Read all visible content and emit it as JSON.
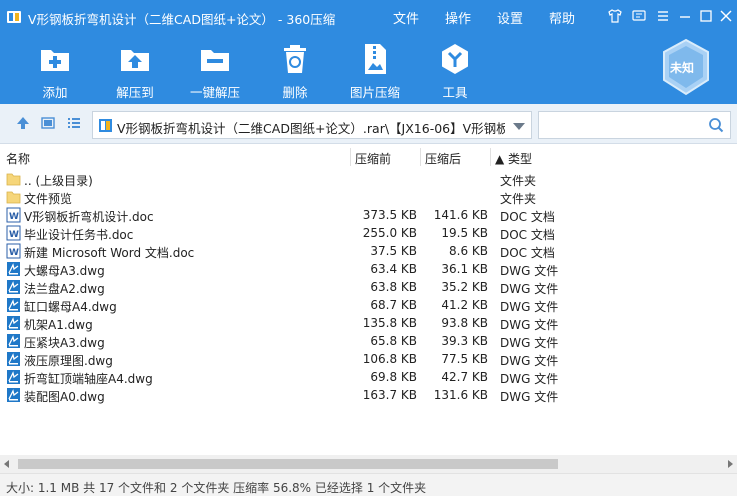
{
  "window": {
    "title": "V形钢板折弯机设计（二维CAD图纸+论文） - 360压缩",
    "menus": [
      "文件",
      "操作",
      "设置",
      "帮助"
    ],
    "accent": "#2f8be0"
  },
  "toolbar": {
    "items": [
      {
        "label": "添加",
        "icon": "add-icon"
      },
      {
        "label": "解压到",
        "icon": "extract-to-icon"
      },
      {
        "label": "一键解压",
        "icon": "one-click-extract-icon"
      },
      {
        "label": "删除",
        "icon": "delete-icon"
      },
      {
        "label": "图片压缩",
        "icon": "image-compress-icon"
      },
      {
        "label": "工具",
        "icon": "tools-icon"
      }
    ],
    "badge_label": "未知"
  },
  "address": {
    "path": "V形钢板折弯机设计（二维CAD图纸+论文）.rar\\【JX16-06】V形钢板折",
    "search_placeholder": ""
  },
  "columns": {
    "name": "名称",
    "compressed": "压缩前",
    "original": "压缩后",
    "type": "▲ 类型"
  },
  "rows": [
    {
      "name": ".. (上级目录)",
      "compressed": "",
      "original": "",
      "type": "文件夹",
      "icon": "folder-icon"
    },
    {
      "name": "文件预览",
      "compressed": "",
      "original": "",
      "type": "文件夹",
      "icon": "folder-icon"
    },
    {
      "name": "V形钢板折弯机设计.doc",
      "compressed": "373.5 KB",
      "original": "141.6 KB",
      "type": "DOC 文档",
      "icon": "doc-icon"
    },
    {
      "name": "毕业设计任务书.doc",
      "compressed": "255.0 KB",
      "original": "19.5 KB",
      "type": "DOC 文档",
      "icon": "doc-icon"
    },
    {
      "name": "新建 Microsoft Word 文档.doc",
      "compressed": "37.5 KB",
      "original": "8.6 KB",
      "type": "DOC 文档",
      "icon": "doc-icon"
    },
    {
      "name": "大螺母A3.dwg",
      "compressed": "63.4 KB",
      "original": "36.1 KB",
      "type": "DWG 文件",
      "icon": "dwg-icon"
    },
    {
      "name": "法兰盘A2.dwg",
      "compressed": "63.8 KB",
      "original": "35.2 KB",
      "type": "DWG 文件",
      "icon": "dwg-icon"
    },
    {
      "name": "缸口螺母A4.dwg",
      "compressed": "68.7 KB",
      "original": "41.2 KB",
      "type": "DWG 文件",
      "icon": "dwg-icon"
    },
    {
      "name": "机架A1.dwg",
      "compressed": "135.8 KB",
      "original": "93.8 KB",
      "type": "DWG 文件",
      "icon": "dwg-icon"
    },
    {
      "name": "压紧块A3.dwg",
      "compressed": "65.8 KB",
      "original": "39.3 KB",
      "type": "DWG 文件",
      "icon": "dwg-icon"
    },
    {
      "name": "液压原理图.dwg",
      "compressed": "106.8 KB",
      "original": "77.5 KB",
      "type": "DWG 文件",
      "icon": "dwg-icon"
    },
    {
      "name": "折弯缸顶端轴座A4.dwg",
      "compressed": "69.8 KB",
      "original": "42.7 KB",
      "type": "DWG 文件",
      "icon": "dwg-icon"
    },
    {
      "name": "装配图A0.dwg",
      "compressed": "163.7 KB",
      "original": "131.6 KB",
      "type": "DWG 文件",
      "icon": "dwg-icon"
    }
  ],
  "status": {
    "text": "大小: 1.1 MB 共 17 个文件和 2 个文件夹 压缩率 56.8% 已经选择 1 个文件夹"
  }
}
